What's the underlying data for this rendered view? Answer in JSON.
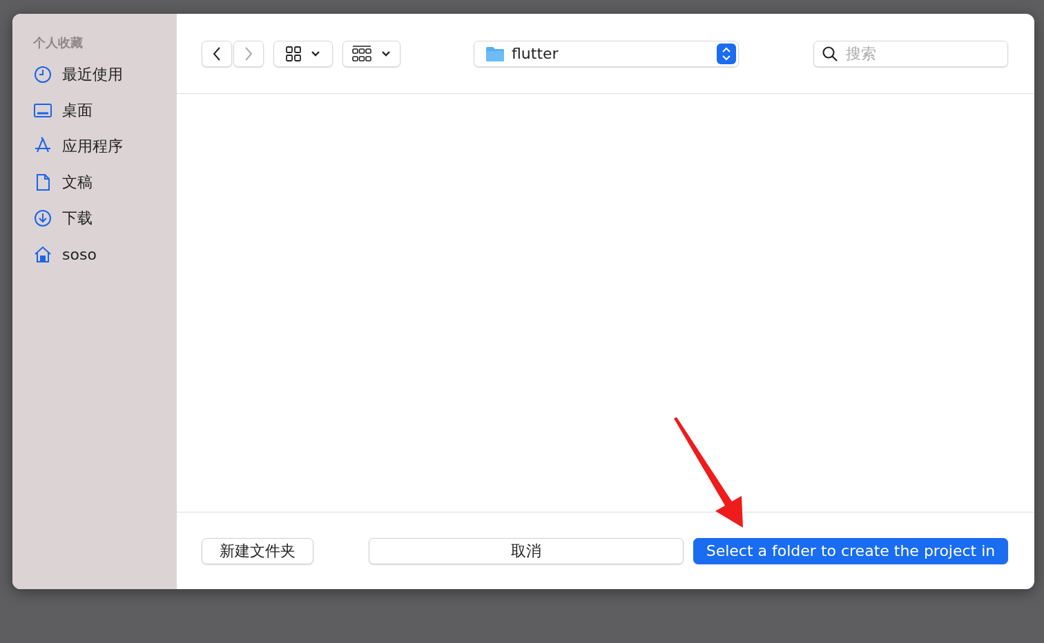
{
  "sidebar": {
    "heading": "个人收藏",
    "items": [
      {
        "label": "最近使用",
        "kind": "recent"
      },
      {
        "label": "桌面",
        "kind": "desktop"
      },
      {
        "label": "应用程序",
        "kind": "apps"
      },
      {
        "label": "文稿",
        "kind": "documents"
      },
      {
        "label": "下载",
        "kind": "downloads"
      },
      {
        "label": "soso",
        "kind": "home"
      }
    ]
  },
  "toolbar": {
    "back": {
      "disabled": false
    },
    "forward": {
      "disabled": true
    },
    "location": "flutter",
    "search": {
      "placeholder": "搜索"
    }
  },
  "footer": {
    "new_folder": "新建文件夹",
    "cancel": "取消",
    "confirm": "Select a folder to create the project in"
  },
  "annotation": {
    "kind": "arrow"
  }
}
